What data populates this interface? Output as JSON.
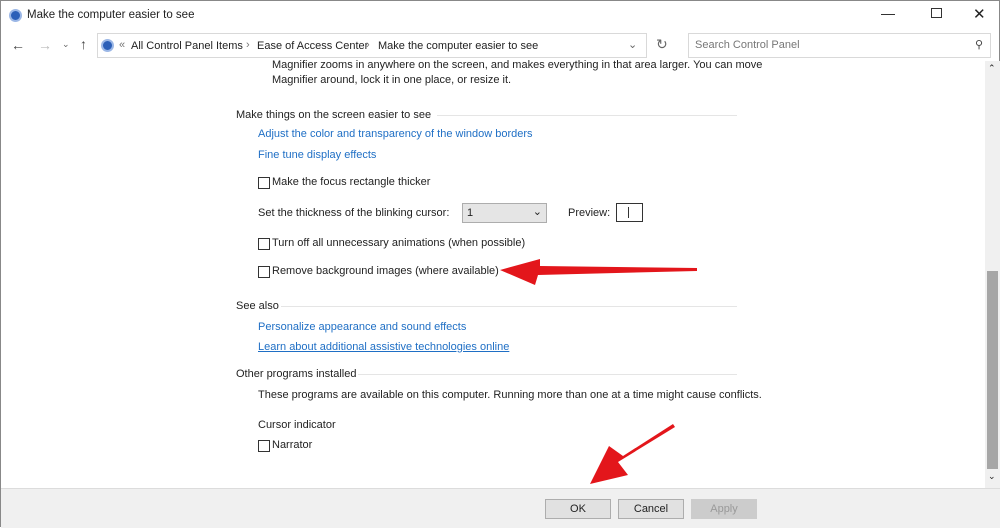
{
  "window": {
    "title": "Make the computer easier to see"
  },
  "nav": {
    "breadcrumb_root": "«",
    "breadcrumb": [
      "All Control Panel Items",
      "Ease of Access Center",
      "Make the computer easier to see"
    ],
    "search_placeholder": "Search Control Panel"
  },
  "intro": {
    "line1": "Magnifier zooms in anywhere on the screen, and makes everything in that area larger. You can move",
    "line2": "Magnifier around, lock it in one place, or resize it."
  },
  "screen": {
    "heading": "Make things on the screen easier to see",
    "link1": "Adjust the color and transparency of the window borders",
    "link2": "Fine tune display effects",
    "focus": "Make the focus rectangle thicker",
    "cursor_label": "Set the thickness of the blinking cursor:",
    "cursor_value": "1",
    "preview_label": "Preview:",
    "animations": "Turn off all unnecessary animations (when possible)",
    "background": "Remove background images (where available)"
  },
  "see_also": {
    "heading": "See also",
    "link1": "Personalize appearance and sound effects",
    "link2": "Learn about additional assistive technologies online"
  },
  "other": {
    "heading": "Other programs installed",
    "desc": "These programs are available on this computer. Running more than one at a time might cause conflicts.",
    "cursor_indicator": "Cursor indicator",
    "narrator": "Narrator"
  },
  "buttons": {
    "ok": "OK",
    "cancel": "Cancel",
    "apply": "Apply"
  },
  "colors": {
    "link": "#1f6fc5",
    "annotation": "#e3161b"
  }
}
